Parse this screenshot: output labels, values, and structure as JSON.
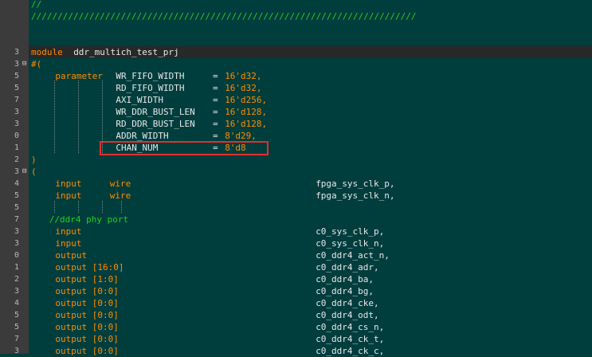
{
  "editor": {
    "colors": {
      "background": "#003d3d",
      "keyword": "#ff8c00",
      "comment": "#1fd11f",
      "text": "#e8e8e8",
      "highlight_box": "#e03030"
    },
    "lines": [
      {
        "num": "",
        "tokens": [
          {
            "t": "//",
            "c": "comment",
            "col": 0
          }
        ]
      },
      {
        "num": "",
        "tokens": [
          {
            "t": "/////////////////////////////////////////////////////////////////////////",
            "c": "comment",
            "col": 0
          }
        ]
      },
      {
        "num": "",
        "tokens": []
      },
      {
        "num": "",
        "tokens": []
      },
      {
        "num": "3",
        "tokens": [
          {
            "t": "module",
            "c": "kw",
            "col": 0
          },
          {
            "t": "ddr_multich_test_prj",
            "c": "id",
            "col": 7
          }
        ],
        "hl": true
      },
      {
        "num": "3",
        "fold": "⊟",
        "tokens": [
          {
            "t": "#(",
            "c": "kw",
            "col": 0
          }
        ]
      },
      {
        "num": "5",
        "tokens": [
          {
            "t": "parameter",
            "c": "kw",
            "col": 4
          },
          {
            "t": "WR_FIFO_WIDTH",
            "c": "id",
            "col": 14
          },
          {
            "t": "=",
            "c": "id",
            "col": 30
          },
          {
            "t": "16'd32,",
            "c": "num",
            "col": 32
          }
        ]
      },
      {
        "num": "5",
        "tokens": [
          {
            "t": "RD_FIFO_WIDTH",
            "c": "id",
            "col": 14
          },
          {
            "t": "=",
            "c": "id",
            "col": 30
          },
          {
            "t": "16'd32,",
            "c": "num",
            "col": 32
          }
        ]
      },
      {
        "num": "7",
        "tokens": [
          {
            "t": "AXI_WIDTH",
            "c": "id",
            "col": 14
          },
          {
            "t": "=",
            "c": "id",
            "col": 30
          },
          {
            "t": "16'd256,",
            "c": "num",
            "col": 32
          }
        ]
      },
      {
        "num": "3",
        "tokens": [
          {
            "t": "WR_DDR_BUST_LEN",
            "c": "id",
            "col": 14
          },
          {
            "t": "=",
            "c": "id",
            "col": 30
          },
          {
            "t": "16'd128,",
            "c": "num",
            "col": 32
          }
        ]
      },
      {
        "num": "3",
        "tokens": [
          {
            "t": "RD_DDR_BUST_LEN",
            "c": "id",
            "col": 14
          },
          {
            "t": "=",
            "c": "id",
            "col": 30
          },
          {
            "t": "16'd128,",
            "c": "num",
            "col": 32
          }
        ]
      },
      {
        "num": "0",
        "tokens": [
          {
            "t": "ADDR_WIDTH",
            "c": "id",
            "col": 14
          },
          {
            "t": "=",
            "c": "id",
            "col": 30
          },
          {
            "t": "8'd29,",
            "c": "num",
            "col": 32
          }
        ]
      },
      {
        "num": "1",
        "tokens": [
          {
            "t": "CHAN_NUM",
            "c": "id",
            "col": 14
          },
          {
            "t": "=",
            "c": "id",
            "col": 30
          },
          {
            "t": "8'd8",
            "c": "num",
            "col": 32
          }
        ]
      },
      {
        "num": "2",
        "tokens": [
          {
            "t": ")",
            "c": "kw",
            "col": 0
          }
        ]
      },
      {
        "num": "3",
        "fold": "⊟",
        "tokens": [
          {
            "t": "(",
            "c": "kw",
            "col": 0
          }
        ]
      },
      {
        "num": "4",
        "tokens": [
          {
            "t": "input",
            "c": "kw",
            "col": 4
          },
          {
            "t": "wire",
            "c": "kw",
            "col": 13
          },
          {
            "t": "fpga_sys_clk_p,",
            "c": "id",
            "col": 47
          }
        ]
      },
      {
        "num": "5",
        "tokens": [
          {
            "t": "input",
            "c": "kw",
            "col": 4
          },
          {
            "t": "wire",
            "c": "kw",
            "col": 13
          },
          {
            "t": "fpga_sys_clk_n,",
            "c": "id",
            "col": 47
          }
        ]
      },
      {
        "num": "5",
        "tokens": []
      },
      {
        "num": "7",
        "tokens": [
          {
            "t": "//ddr4 phy port",
            "c": "comment",
            "col": 3
          }
        ]
      },
      {
        "num": "3",
        "tokens": [
          {
            "t": "input",
            "c": "kw",
            "col": 4
          },
          {
            "t": "c0_sys_clk_p,",
            "c": "id",
            "col": 47
          }
        ]
      },
      {
        "num": "3",
        "tokens": [
          {
            "t": "input",
            "c": "kw",
            "col": 4
          },
          {
            "t": "c0_sys_clk_n,",
            "c": "id",
            "col": 47
          }
        ]
      },
      {
        "num": "0",
        "tokens": [
          {
            "t": "output",
            "c": "kw",
            "col": 4
          },
          {
            "t": "c0_ddr4_act_n,",
            "c": "id",
            "col": 47
          }
        ]
      },
      {
        "num": "1",
        "tokens": [
          {
            "t": "output [16:0]",
            "c": "kw",
            "col": 4
          },
          {
            "t": "c0_ddr4_adr,",
            "c": "id",
            "col": 47
          }
        ]
      },
      {
        "num": "2",
        "tokens": [
          {
            "t": "output [1:0]",
            "c": "kw",
            "col": 4
          },
          {
            "t": "c0_ddr4_ba,",
            "c": "id",
            "col": 47
          }
        ]
      },
      {
        "num": "3",
        "tokens": [
          {
            "t": "output [0:0]",
            "c": "kw",
            "col": 4
          },
          {
            "t": "c0_ddr4_bg,",
            "c": "id",
            "col": 47
          }
        ]
      },
      {
        "num": "4",
        "tokens": [
          {
            "t": "output [0:0]",
            "c": "kw",
            "col": 4
          },
          {
            "t": "c0_ddr4_cke,",
            "c": "id",
            "col": 47
          }
        ]
      },
      {
        "num": "5",
        "tokens": [
          {
            "t": "output [0:0]",
            "c": "kw",
            "col": 4
          },
          {
            "t": "c0_ddr4_odt,",
            "c": "id",
            "col": 47
          }
        ]
      },
      {
        "num": "5",
        "tokens": [
          {
            "t": "output [0:0]",
            "c": "kw",
            "col": 4
          },
          {
            "t": "c0_ddr4_cs_n,",
            "c": "id",
            "col": 47
          }
        ]
      },
      {
        "num": "7",
        "tokens": [
          {
            "t": "output [0:0]",
            "c": "kw",
            "col": 4
          },
          {
            "t": "c0_ddr4_ck_t,",
            "c": "id",
            "col": 47
          }
        ]
      },
      {
        "num": "3",
        "tokens": [
          {
            "t": "output [0:0]",
            "c": "kw",
            "col": 4
          },
          {
            "t": "c0_ddr4_ck_c,",
            "c": "id",
            "col": 47
          }
        ]
      }
    ]
  }
}
